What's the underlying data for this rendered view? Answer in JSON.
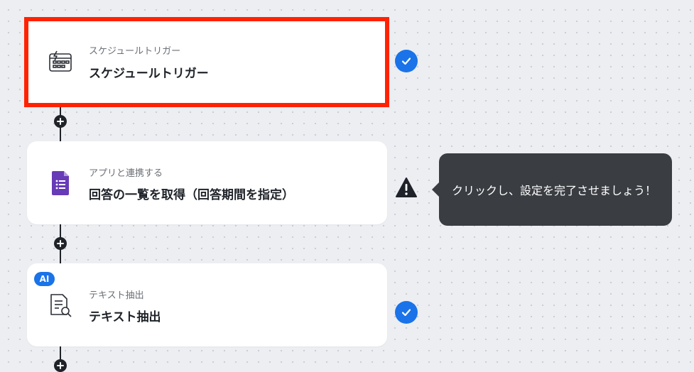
{
  "flow": {
    "steps": [
      {
        "subtitle": "スケジュールトリガー",
        "title": "スケジュールトリガー",
        "icon": "schedule-trigger-icon",
        "status": "complete",
        "selected": true
      },
      {
        "subtitle": "アプリと連携する",
        "title": "回答の一覧を取得（回答期間を指定）",
        "icon": "google-forms-icon",
        "status": "warning"
      },
      {
        "subtitle": "テキスト抽出",
        "title": "テキスト抽出",
        "icon": "document-search-icon",
        "status": "complete",
        "badge": "AI"
      }
    ]
  },
  "tooltip": {
    "text": "クリックし、設定を完了させましょう！"
  },
  "colors": {
    "accent": "#1a73e8",
    "selection_border": "#ff2200",
    "connector": "#1f2329",
    "tooltip_bg": "#3a3d42",
    "forms_purple": "#673ab7"
  }
}
